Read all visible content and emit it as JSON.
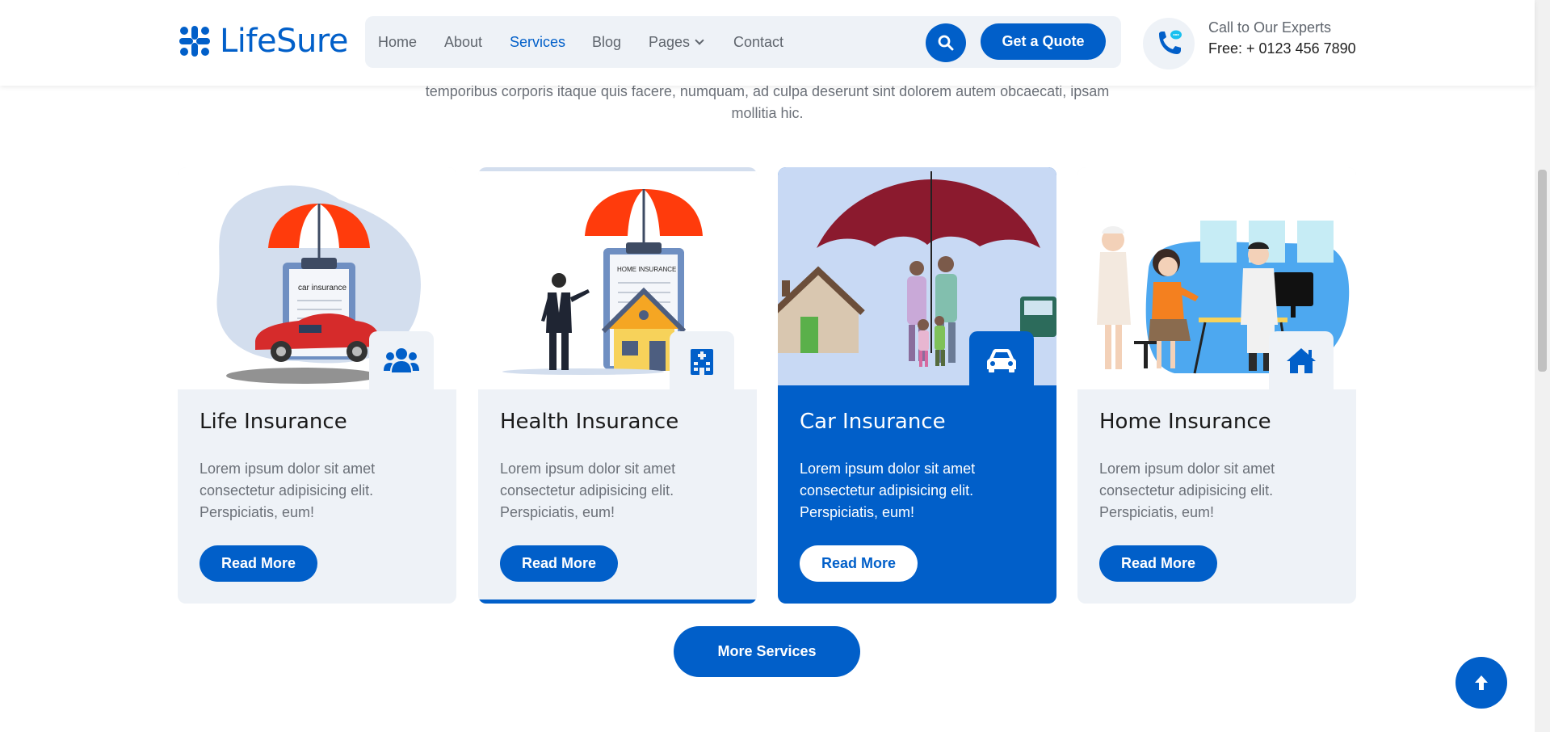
{
  "brand": {
    "name": "LifeSure",
    "accent": "#015fc9",
    "surface": "#eef2f7"
  },
  "nav": {
    "items": [
      {
        "label": "Home"
      },
      {
        "label": "About"
      },
      {
        "label": "Services",
        "active": true
      },
      {
        "label": "Blog"
      },
      {
        "label": "Pages",
        "dropdown": true
      },
      {
        "label": "Contact"
      }
    ],
    "search_icon": "search-icon",
    "quote_label": "Get a Quote"
  },
  "contact": {
    "icon": "phone-chat-icon",
    "title": "Call to Our Experts",
    "number": "Free: + 0123 456 7890"
  },
  "intro": {
    "text": "temporibus corporis itaque quis facere, numquam, ad culpa deserunt sint dolorem autem obcaecati, ipsam mollitia hic."
  },
  "services": [
    {
      "title": "Life Insurance",
      "text": "Lorem ipsum dolor sit amet consectetur adipisicing elit. Perspiciatis, eum!",
      "button": "Read More",
      "icon": "users-icon",
      "image_label": "car insurance"
    },
    {
      "title": "Health Insurance",
      "text": "Lorem ipsum dolor sit amet consectetur adipisicing elit. Perspiciatis, eum!",
      "button": "Read More",
      "icon": "hospital-icon",
      "image_label": "HOME INSURANCE"
    },
    {
      "title": "Car Insurance",
      "text": "Lorem ipsum dolor sit amet consectetur adipisicing elit. Perspiciatis, eum!",
      "button": "Read More",
      "icon": "car-icon",
      "active": true
    },
    {
      "title": "Home Insurance",
      "text": "Lorem ipsum dolor sit amet consectetur adipisicing elit. Perspiciatis, eum!",
      "button": "Read More",
      "icon": "home-icon"
    }
  ],
  "more_services": "More Services",
  "back_to_top_icon": "arrow-up-icon"
}
